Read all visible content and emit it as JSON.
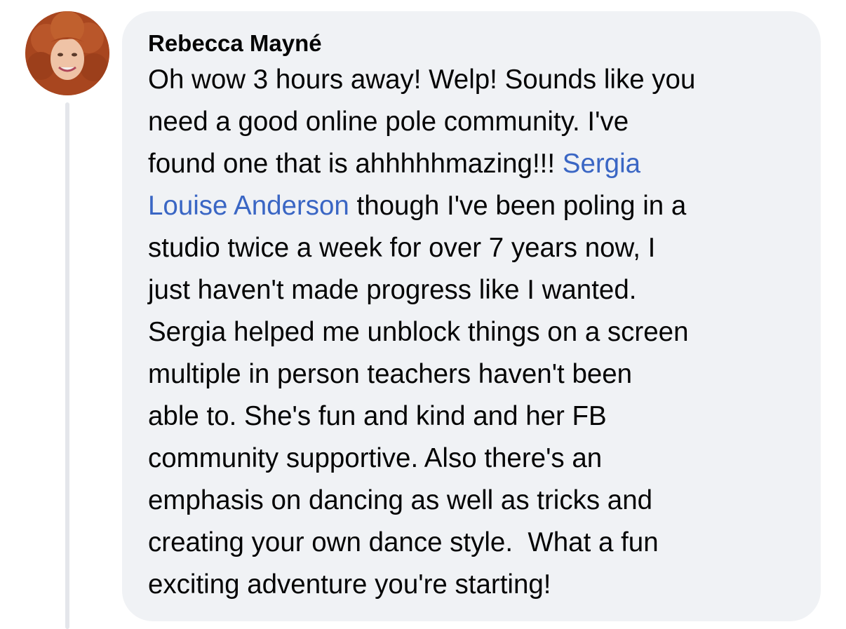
{
  "comment": {
    "author": "Rebecca Mayné",
    "avatar_icon": "profile-photo",
    "mention": "Sergia Louise Anderson",
    "mention_color": "#3a66c4",
    "bubble_color": "#f0f2f5",
    "lines": {
      "l1": "Oh wow 3 hours away! Welp! Sounds like you",
      "l2": "need a good online pole community. I've",
      "l3_before": "found one that is ahhhhhmazing!!! ",
      "l3_mention": "Sergia",
      "l4_mention": "Louise Anderson",
      "l4_after": " though I've been poling in a",
      "l5": "studio twice a week for over 7 years now, I",
      "l6": "just haven't made progress like I wanted.",
      "l7": "Sergia helped me unblock things on a screen",
      "l8": "multiple in person teachers haven't been",
      "l9": "able to. She's fun and kind and her FB",
      "l10": "community supportive. Also there's an",
      "l11": "emphasis on dancing as well as tricks and",
      "l12": "creating your own dance style.  What a fun",
      "l13": "exciting adventure you're starting!"
    }
  }
}
